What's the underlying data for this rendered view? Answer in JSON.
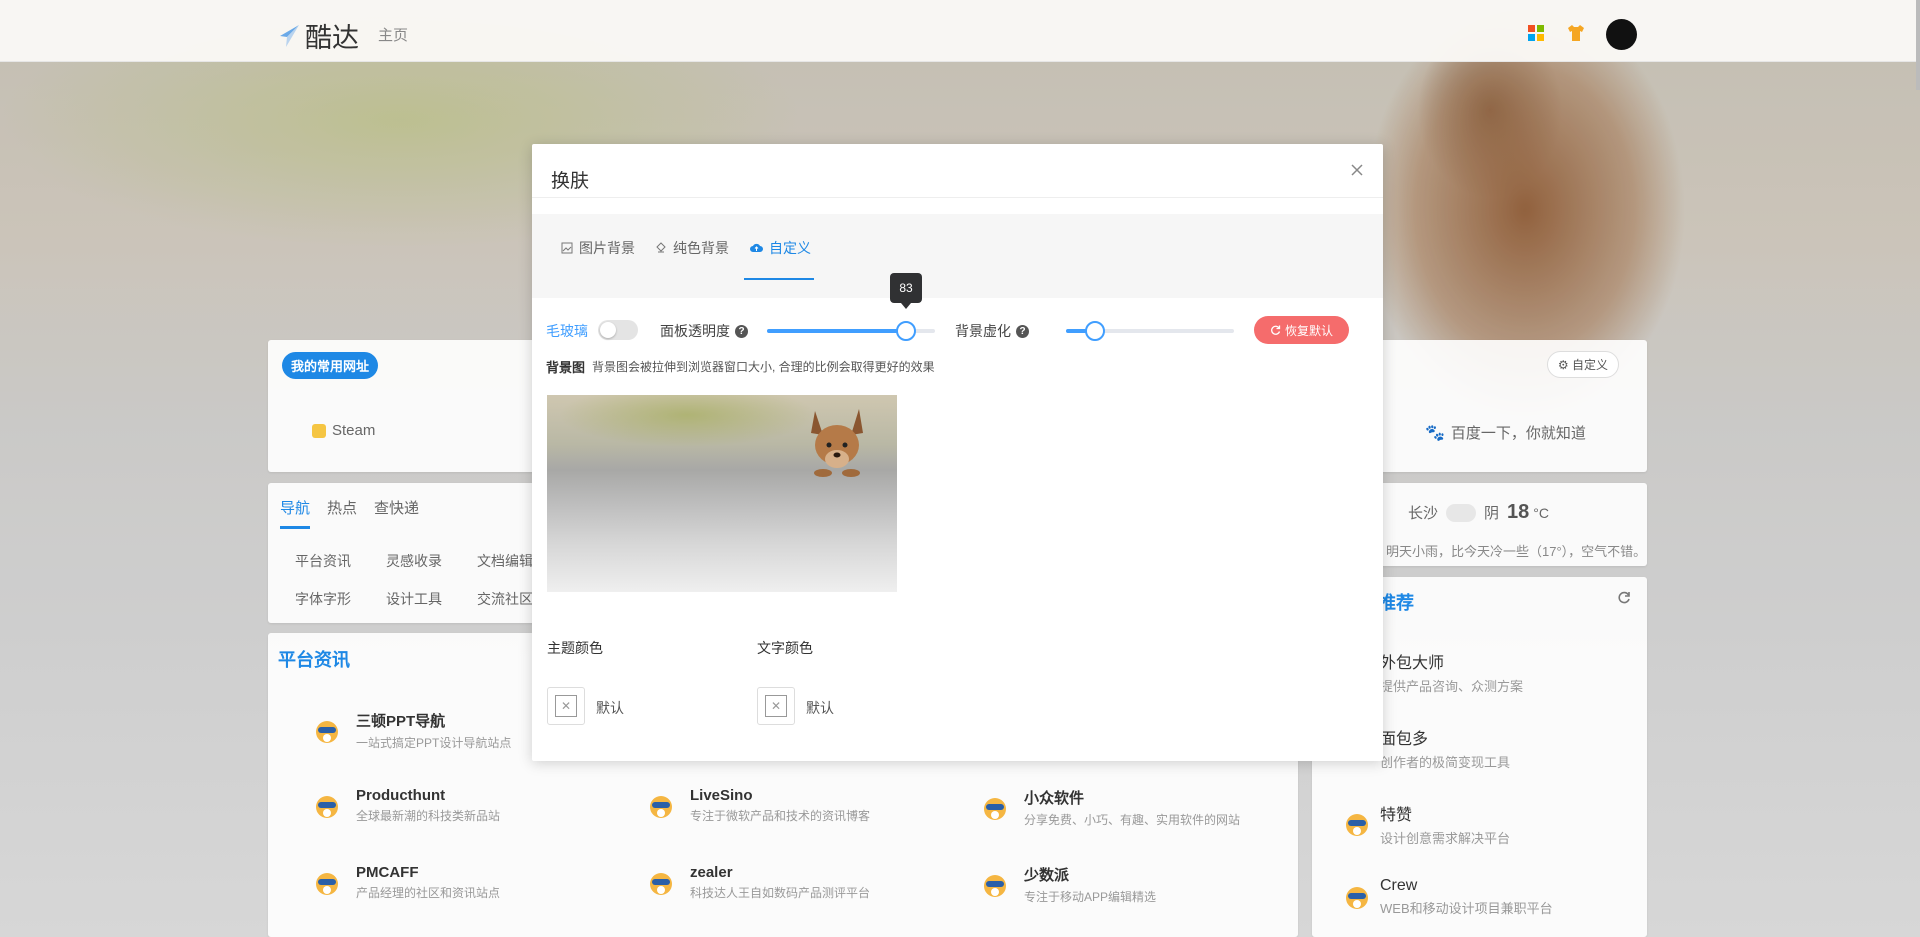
{
  "header": {
    "logo_text": "酷达",
    "home_link": "主页"
  },
  "favorites": {
    "badge": "我的常用网址",
    "custom_button": "自定义",
    "items": [
      "Steam",
      "百度一下，你就知道"
    ]
  },
  "nav": {
    "tabs": [
      "导航",
      "热点",
      "查快递"
    ],
    "links": [
      "平台资讯",
      "灵感收录",
      "文档编辑",
      "字体字形",
      "设计工具",
      "交流社区"
    ]
  },
  "weather": {
    "city": "长沙",
    "condition": "阴",
    "temp": "18",
    "unit": "°C",
    "forecast": "明天小雨，比今天冷一些（17°），空气不错。"
  },
  "recommend": {
    "title": "推荐",
    "items": [
      {
        "title": "外包大师",
        "desc": "提供产品咨询、众测方案"
      },
      {
        "title": "面包多",
        "desc": "创作者的极简变现工具"
      },
      {
        "title": "特赞",
        "desc": "设计创意需求解决平台"
      },
      {
        "title": "Crew",
        "desc": "WEB和移动设计项目兼职平台"
      }
    ]
  },
  "platform": {
    "title": "平台资讯",
    "sites": [
      {
        "title": "三顿PPT导航",
        "desc": "一站式搞定PPT设计导航站点"
      },
      {
        "title": "Producthunt",
        "desc": "全球最新潮的科技类新品站"
      },
      {
        "title": "LiveSino",
        "desc": "专注于微软产品和技术的资讯博客"
      },
      {
        "title": "小众软件",
        "desc": "分享免费、小巧、有趣、实用软件的网站"
      },
      {
        "title": "PMCAFF",
        "desc": "产品经理的社区和资讯站点"
      },
      {
        "title": "zealer",
        "desc": "科技达人王自如数码产品测评平台"
      },
      {
        "title": "少数派",
        "desc": "专注于移动APP编辑精选"
      }
    ]
  },
  "modal": {
    "title": "换肤",
    "tabs": [
      "图片背景",
      "纯色背景",
      "自定义"
    ],
    "active_tab": "自定义",
    "frosted_label": "毛玻璃",
    "frosted_enabled": false,
    "opacity_label": "面板透明度",
    "opacity_value": 83,
    "opacity_tooltip": "83",
    "blur_label": "背景虚化",
    "blur_value": 17,
    "reset_label": "恢复默认",
    "bg_label": "背景图",
    "bg_hint": "背景图会被拉伸到浏览器窗口大小, 合理的比例会取得更好的效果",
    "theme_color_label": "主题颜色",
    "text_color_label": "文字颜色",
    "theme_color_value": "默认",
    "text_color_value": "默认"
  },
  "colors": {
    "accent": "#1e88e5",
    "slider": "#409eff",
    "reset": "#f56c6c"
  }
}
